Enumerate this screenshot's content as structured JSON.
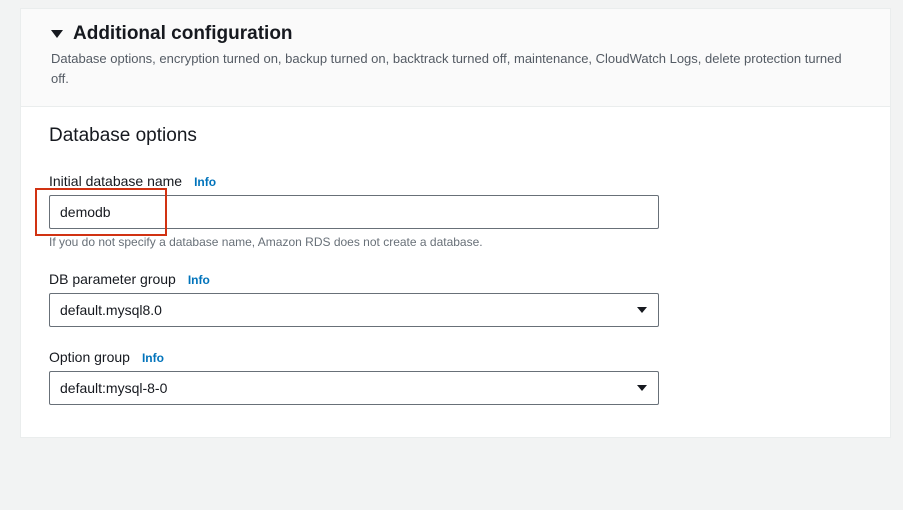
{
  "header": {
    "title": "Additional configuration",
    "subtitle": "Database options, encryption turned on, backup turned on, backtrack turned off, maintenance, CloudWatch Logs, delete protection turned off."
  },
  "body": {
    "heading": "Database options",
    "initial_db": {
      "label": "Initial database name",
      "info": "Info",
      "value": "demodb",
      "helper": "If you do not specify a database name, Amazon RDS does not create a database."
    },
    "param_group": {
      "label": "DB parameter group",
      "info": "Info",
      "value": "default.mysql8.0"
    },
    "option_group": {
      "label": "Option group",
      "info": "Info",
      "value": "default:mysql-8-0"
    }
  }
}
